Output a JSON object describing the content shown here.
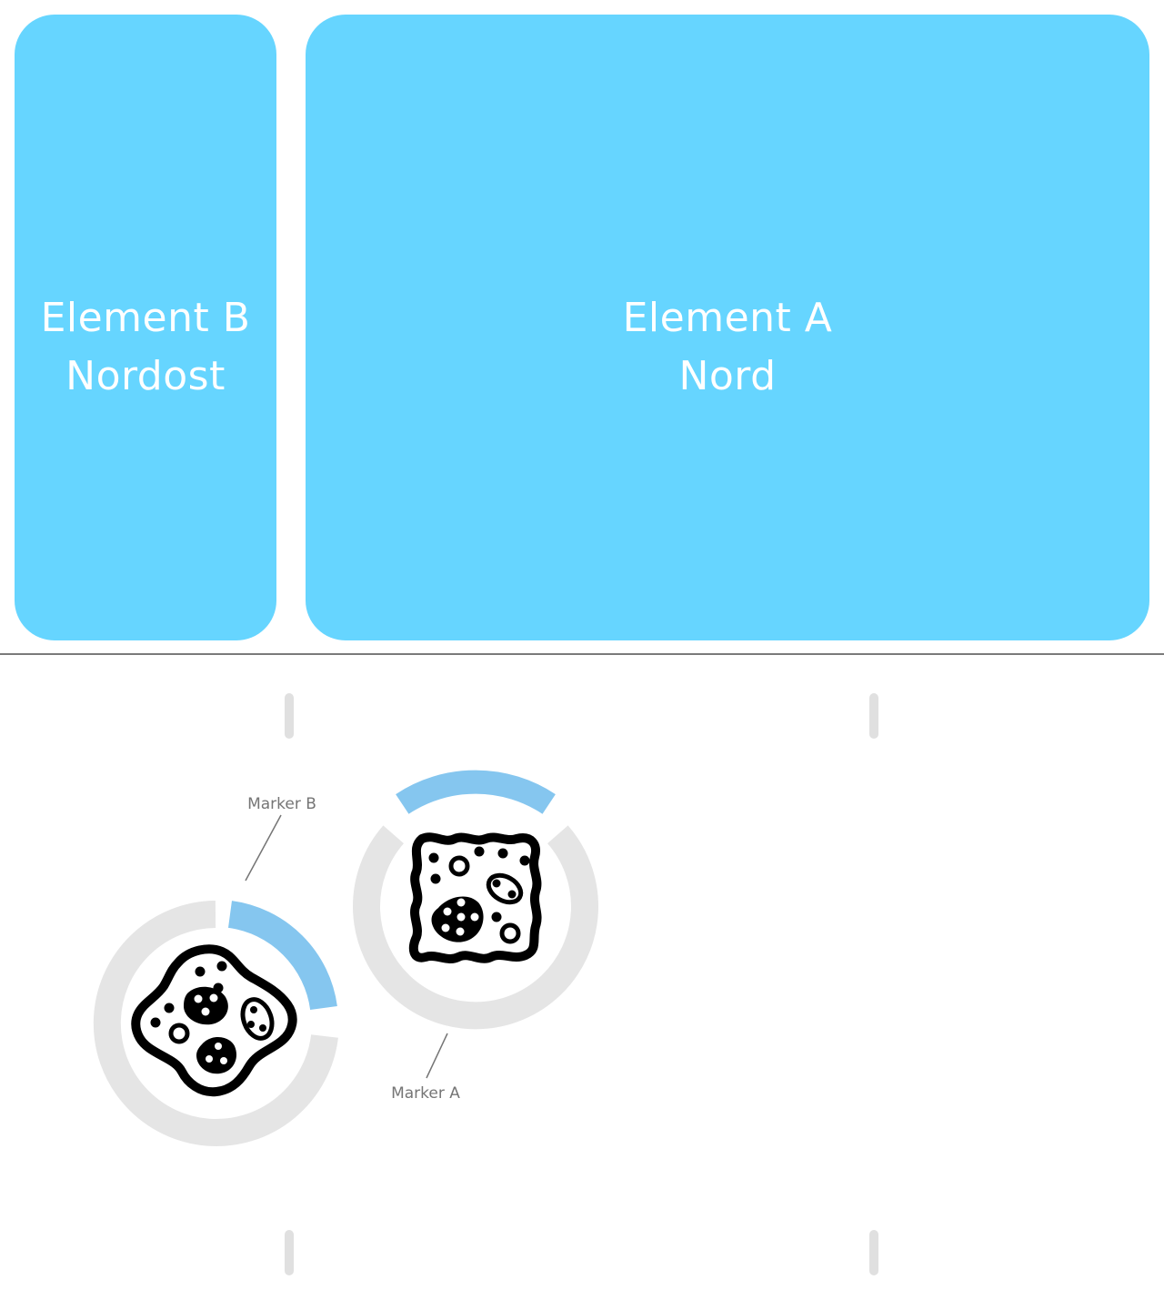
{
  "panels": {
    "element_b": {
      "line1": "Element B",
      "line2": "Nordost"
    },
    "element_a": {
      "line1": "Element A",
      "line2": "Nord"
    }
  },
  "markers": {
    "marker_a": {
      "label": "Marker A",
      "icon": "cell-cluster-square-icon"
    },
    "marker_b": {
      "label": "Marker B",
      "icon": "cell-cluster-blob-icon"
    }
  },
  "colors": {
    "panel_fill": "#66d5ff",
    "ring_track": "#e5e5e5",
    "ring_accent": "#85c6ef",
    "tick": "#e0e0e0",
    "divider": "#7a7a7a",
    "label": "#757575"
  }
}
